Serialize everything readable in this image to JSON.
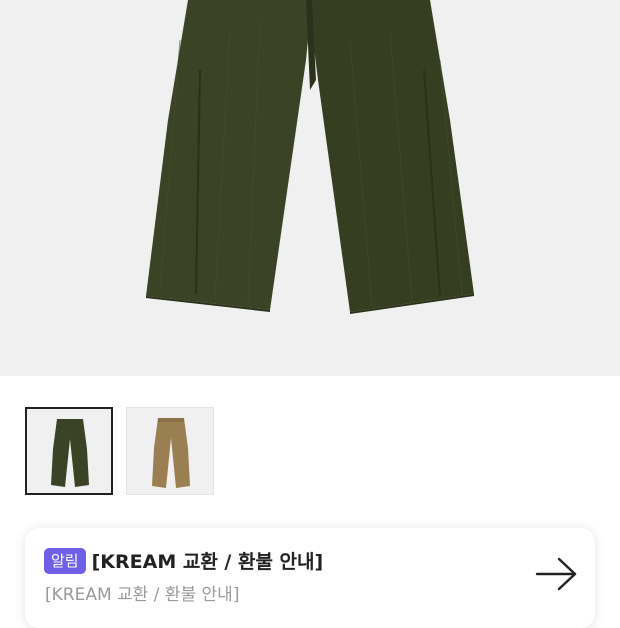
{
  "product": {
    "colors": [
      "#3b4326",
      "#9a7f52"
    ],
    "selected_color_index": 0,
    "gallery_bg": "#f0f0f0"
  },
  "notice": {
    "badge": "알림",
    "badge_color": "#7060e8",
    "title": "[KREAM 교환 / 환불 안내]",
    "subtitle": "[KREAM 교환 / 환불 안내]",
    "action_icon": "arrow-right-icon"
  }
}
